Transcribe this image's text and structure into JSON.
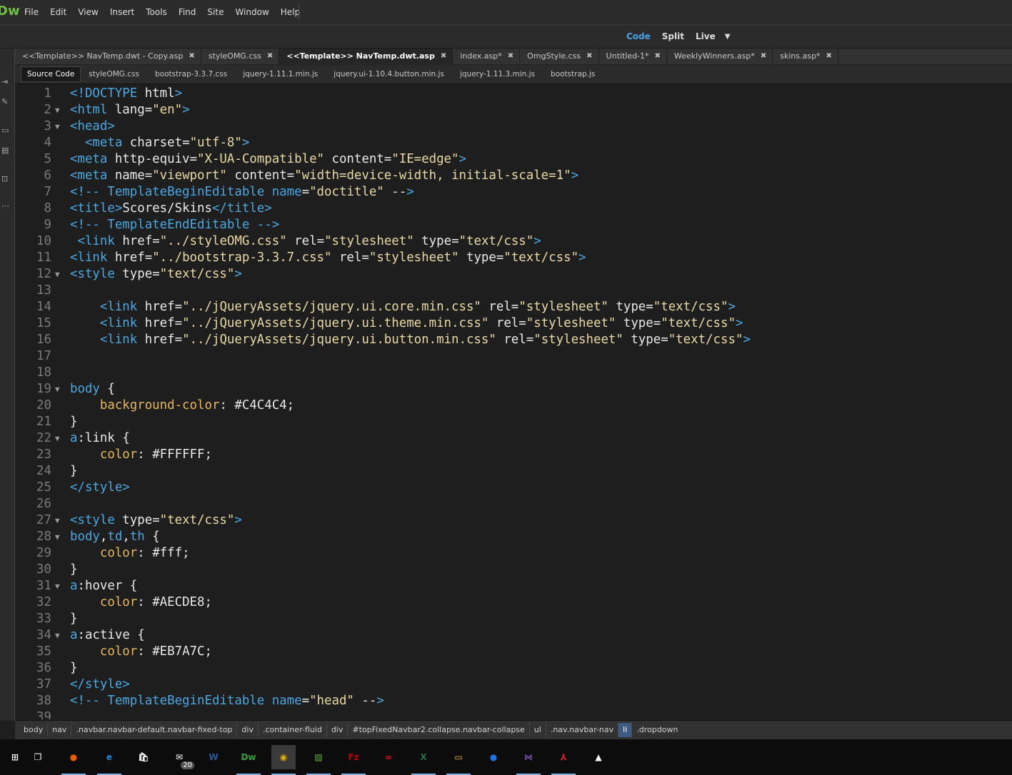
{
  "app": {
    "logo": "Dw"
  },
  "menu": [
    "File",
    "Edit",
    "View",
    "Insert",
    "Tools",
    "Find",
    "Site",
    "Window",
    "Help"
  ],
  "view_modes": {
    "code": "Code",
    "split": "Split",
    "live": "Live"
  },
  "document_tabs": [
    {
      "label": "<<Template>> NavTemp.dwt - Copy.asp",
      "active": false
    },
    {
      "label": "styleOMG.css",
      "active": false
    },
    {
      "label": "<<Template>> NavTemp.dwt.asp",
      "active": true
    },
    {
      "label": "index.asp*",
      "active": false
    },
    {
      "label": "OmgStyle.css",
      "active": false
    },
    {
      "label": "Untitled-1*",
      "active": false
    },
    {
      "label": "WeeklyWinners.asp*",
      "active": false
    },
    {
      "label": "skins.asp*",
      "active": false
    }
  ],
  "related_files": [
    "Source Code",
    "styleOMG.css",
    "bootstrap-3.3.7.css",
    "jquery-1.11.1.min.js",
    "jquery.ui-1.10.4.button.min.js",
    "jquery-1.11.3.min.js",
    "bootstrap.js"
  ],
  "code_lines": [
    {
      "n": "1",
      "fold": false,
      "text": "<!DOCTYPE html>"
    },
    {
      "n": "2",
      "fold": true,
      "text": "<html lang=\"en\">"
    },
    {
      "n": "3",
      "fold": true,
      "text": "<head>"
    },
    {
      "n": "4",
      "fold": false,
      "text": "  <meta charset=\"utf-8\">"
    },
    {
      "n": "5",
      "fold": false,
      "text": "<meta http-equiv=\"X-UA-Compatible\" content=\"IE=edge\">"
    },
    {
      "n": "6",
      "fold": false,
      "text": "<meta name=\"viewport\" content=\"width=device-width, initial-scale=1\">"
    },
    {
      "n": "7",
      "fold": false,
      "text": "<!-- TemplateBeginEditable name=\"doctitle\" -->"
    },
    {
      "n": "8",
      "fold": false,
      "text": "<title>Scores/Skins</title>"
    },
    {
      "n": "9",
      "fold": false,
      "text": "<!-- TemplateEndEditable -->"
    },
    {
      "n": "10",
      "fold": false,
      "text": " <link href=\"../styleOMG.css\" rel=\"stylesheet\" type=\"text/css\">"
    },
    {
      "n": "11",
      "fold": false,
      "text": "<link href=\"../bootstrap-3.3.7.css\" rel=\"stylesheet\" type=\"text/css\">"
    },
    {
      "n": "12",
      "fold": true,
      "text": "<style type=\"text/css\">"
    },
    {
      "n": "13",
      "fold": false,
      "text": ""
    },
    {
      "n": "14",
      "fold": false,
      "text": "    <link href=\"../jQueryAssets/jquery.ui.core.min.css\" rel=\"stylesheet\" type=\"text/css\">"
    },
    {
      "n": "15",
      "fold": false,
      "text": "    <link href=\"../jQueryAssets/jquery.ui.theme.min.css\" rel=\"stylesheet\" type=\"text/css\">"
    },
    {
      "n": "16",
      "fold": false,
      "text": "    <link href=\"../jQueryAssets/jquery.ui.button.min.css\" rel=\"stylesheet\" type=\"text/css\">"
    },
    {
      "n": "17",
      "fold": false,
      "text": ""
    },
    {
      "n": "18",
      "fold": false,
      "text": ""
    },
    {
      "n": "19",
      "fold": true,
      "text": "body {"
    },
    {
      "n": "20",
      "fold": false,
      "text": "    background-color: #C4C4C4;"
    },
    {
      "n": "21",
      "fold": false,
      "text": "}"
    },
    {
      "n": "22",
      "fold": true,
      "text": "a:link {"
    },
    {
      "n": "23",
      "fold": false,
      "text": "    color: #FFFFFF;"
    },
    {
      "n": "24",
      "fold": false,
      "text": "}"
    },
    {
      "n": "25",
      "fold": false,
      "text": "</style>"
    },
    {
      "n": "26",
      "fold": false,
      "text": ""
    },
    {
      "n": "27",
      "fold": true,
      "text": "<style type=\"text/css\">"
    },
    {
      "n": "28",
      "fold": true,
      "text": "body,td,th {"
    },
    {
      "n": "29",
      "fold": false,
      "text": "    color: #fff;"
    },
    {
      "n": "30",
      "fold": false,
      "text": "}"
    },
    {
      "n": "31",
      "fold": true,
      "text": "a:hover {"
    },
    {
      "n": "32",
      "fold": false,
      "text": "    color: #AECDE8;"
    },
    {
      "n": "33",
      "fold": false,
      "text": "}"
    },
    {
      "n": "34",
      "fold": true,
      "text": "a:active {"
    },
    {
      "n": "35",
      "fold": false,
      "text": "    color: #EB7A7C;"
    },
    {
      "n": "36",
      "fold": false,
      "text": "}"
    },
    {
      "n": "37",
      "fold": false,
      "text": "</style>"
    },
    {
      "n": "38",
      "fold": false,
      "text": "<!-- TemplateBeginEditable name=\"head\" -->"
    },
    {
      "n": "39",
      "fold": false,
      "text": ""
    }
  ],
  "status_path": [
    {
      "label": "body",
      "selected": false
    },
    {
      "label": "nav",
      "selected": false
    },
    {
      "label": ".navbar.navbar-default.navbar-fixed-top",
      "selected": false
    },
    {
      "label": "div",
      "selected": false
    },
    {
      "label": ".container-fluid",
      "selected": false
    },
    {
      "label": "div",
      "selected": false
    },
    {
      "label": "#topFixedNavbar2.collapse.navbar-collapse",
      "selected": false
    },
    {
      "label": "ul",
      "selected": false
    },
    {
      "label": ".nav.navbar-nav",
      "selected": false
    },
    {
      "label": "li",
      "selected": true
    },
    {
      "label": ".dropdown",
      "selected": false
    }
  ],
  "taskbar": [
    {
      "name": "start-icon",
      "glyph": "⊞",
      "color": "#ffffff",
      "open": false
    },
    {
      "name": "task-view-icon",
      "glyph": "❐",
      "color": "#ffffff",
      "open": false
    },
    {
      "name": "firefox-icon",
      "glyph": "●",
      "color": "#e66000",
      "open": true
    },
    {
      "name": "edge-icon",
      "glyph": "e",
      "color": "#1e88e5",
      "open": true
    },
    {
      "name": "store-icon",
      "glyph": "🛍",
      "color": "#ffffff",
      "open": false
    },
    {
      "name": "mail-icon",
      "glyph": "✉",
      "color": "#ffffff",
      "open": false,
      "badge": "20"
    },
    {
      "name": "word-icon",
      "glyph": "W",
      "color": "#2b579a",
      "open": false
    },
    {
      "name": "dreamweaver-icon",
      "glyph": "Dw",
      "color": "#35a23a",
      "open": true
    },
    {
      "name": "chrome-icon",
      "glyph": "◉",
      "color": "#e0b000",
      "open": true,
      "running": true
    },
    {
      "name": "image-viewer-icon",
      "glyph": "▨",
      "color": "#6bb33a",
      "open": true
    },
    {
      "name": "filezilla-icon",
      "glyph": "Fz",
      "color": "#bf0000",
      "open": true
    },
    {
      "name": "creative-cloud-icon",
      "glyph": "∞",
      "color": "#d11",
      "open": false
    },
    {
      "name": "excel-icon",
      "glyph": "X",
      "color": "#217346",
      "open": true
    },
    {
      "name": "file-explorer-icon",
      "glyph": "▭",
      "color": "#f2b84b",
      "open": true
    },
    {
      "name": "firefox-dev-icon",
      "glyph": "●",
      "color": "#1a73e8",
      "open": false
    },
    {
      "name": "visual-studio-icon",
      "glyph": "⋈",
      "color": "#7b52ab",
      "open": true
    },
    {
      "name": "acrobat-icon",
      "glyph": "⅄",
      "color": "#e02020",
      "open": true
    },
    {
      "name": "photos-icon",
      "glyph": "▲",
      "color": "#ffffff",
      "open": false
    }
  ]
}
